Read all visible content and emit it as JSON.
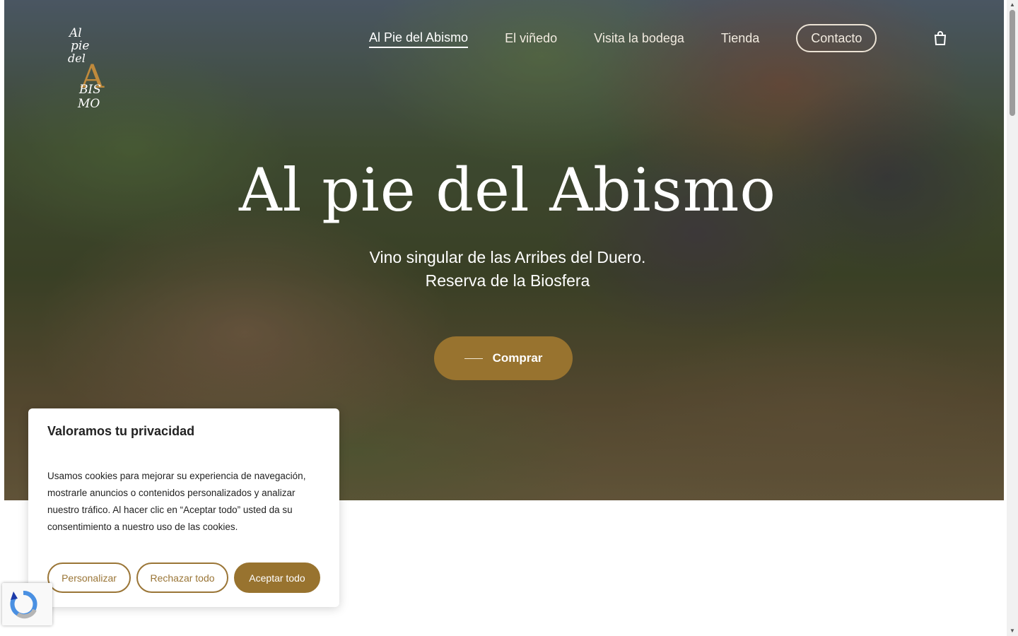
{
  "brand": {
    "logo_text_lines": [
      "Al",
      "pie",
      "del",
      "A",
      "BIS",
      "MO"
    ],
    "accent_color": "#98732f"
  },
  "nav": {
    "items": [
      {
        "label": "Al Pie del Abismo",
        "active": true
      },
      {
        "label": "El viñedo"
      },
      {
        "label": "Visita la bodega"
      },
      {
        "label": "Tienda"
      },
      {
        "label": "Contacto"
      }
    ],
    "cart_icon": "shopping-bag-icon"
  },
  "hero": {
    "title": "Al pie del Abismo",
    "subtitle_line1": "Vino singular de las Arribes del Duero.",
    "subtitle_line2": "Reserva de la Biosfera",
    "cta_label": "Comprar"
  },
  "cookie": {
    "title": "Valoramos tu privacidad",
    "text": "Usamos cookies para mejorar su experiencia de navegación, mostrarle anuncios o contenidos personalizados y analizar nuestro tráfico. Al hacer clic en “Aceptar todo” usted da su consentimiento a nuestro uso de las cookies.",
    "btn_customize": "Personalizar",
    "btn_reject": "Rechazar todo",
    "btn_accept": "Aceptar todo"
  },
  "recaptcha": {
    "icon": "recaptcha-icon"
  }
}
